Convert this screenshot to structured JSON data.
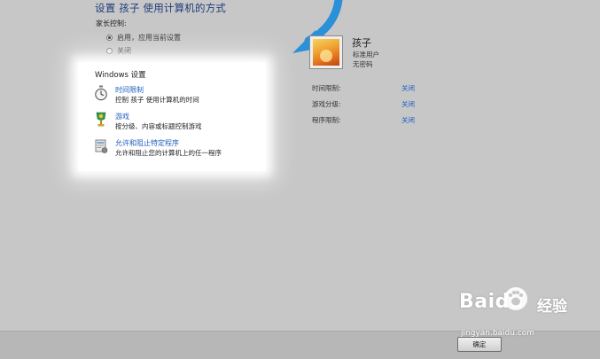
{
  "header": {
    "title": "设置 孩子 使用计算机的方式"
  },
  "parental_controls": {
    "label": "家长控制:",
    "options": [
      {
        "label": "启用，应用当前设置",
        "selected": true
      },
      {
        "label": "关闭",
        "selected": false
      }
    ]
  },
  "windows_settings": {
    "title": "Windows 设置",
    "items": [
      {
        "icon": "stopwatch-icon",
        "link": "时间限制",
        "description": "控制 孩子 使用计算机的时间"
      },
      {
        "icon": "trophy-icon",
        "link": "游戏",
        "description": "按分级、内容或标题控制游戏"
      },
      {
        "icon": "program-icon",
        "link": "允许和阻止特定程序",
        "description": "允许和阻止您的计算机上的任一程序"
      }
    ]
  },
  "user": {
    "name": "孩子",
    "account_type": "标准用户",
    "password_status": "无密码"
  },
  "status": [
    {
      "label": "时间限制:",
      "value": "关闭"
    },
    {
      "label": "游戏分级:",
      "value": "关闭"
    },
    {
      "label": "程序限制:",
      "value": "关闭"
    }
  ],
  "footer": {
    "ok_label": "确定"
  },
  "watermark": {
    "brand": "Baidu",
    "text_cn": "经验",
    "url": "jingyan.baidu.com"
  },
  "colors": {
    "link": "#1f5fbf",
    "title": "#1f3d7a",
    "arrow": "#2a90d8",
    "background": "#c7c7c7"
  }
}
